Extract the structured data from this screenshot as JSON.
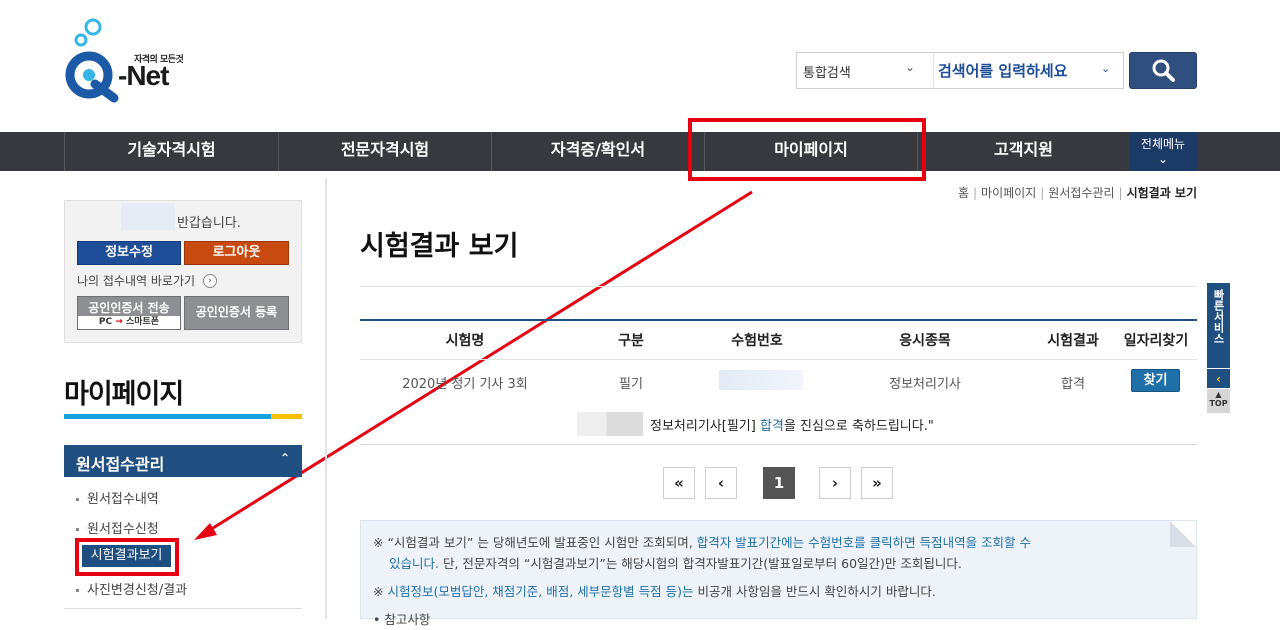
{
  "header": {
    "logo_tagline": "자격의 모든것",
    "logo_text": "-Net",
    "search_category": "통합검색",
    "search_placeholder": "검색어를 입력하세요"
  },
  "nav": {
    "items": [
      "기술자격시험",
      "전문자격시험",
      "자격증/확인서",
      "마이페이지",
      "고객지원"
    ],
    "all_menu": "전체메뉴"
  },
  "sidebar": {
    "greeting": "반갑습니다.",
    "edit_info": "정보수정",
    "logout": "로그아웃",
    "shortcut": "나의 접수내역 바로가기",
    "cert_send": "공인인증서 전송",
    "cert_send_sub_from": "PC",
    "cert_send_sub_to": "스마트폰",
    "cert_register": "공인인증서 등록",
    "section_title": "마이페이지",
    "menu_head": "원서접수관리",
    "items": [
      "원서접수내역",
      "원서접수신청",
      "시험결과보기",
      "사진변경신청/결과"
    ]
  },
  "main": {
    "breadcrumb": [
      "홈",
      "마이페이지",
      "원서접수관리",
      "시험결과 보기"
    ],
    "title": "시험결과 보기",
    "table": {
      "headers": [
        "시험명",
        "구분",
        "수험번호",
        "응시종목",
        "시험결과",
        "일자리찾기"
      ],
      "row": {
        "exam": "2020년 정기 기사 3회",
        "type": "필기",
        "subject": "정보처리기사",
        "result": "합격",
        "find_btn": "찾기"
      }
    },
    "congrats_pre": "정보처리기사[필기]",
    "congrats_hl": "합격",
    "congrats_post": "을 진심으로 축하드립니다.\"",
    "pagination": [
      "«",
      "‹",
      "1",
      "›",
      "»"
    ],
    "notice": {
      "line1_a": "※ “시험결과 보기” 는 당해년도에 발표중인 시험만 조회되며, ",
      "line1_b": "합격자 발표기간에는 수험번호를 클릭하면 득점내역을 조회할 수",
      "line2_a": "있습니다.",
      "line2_b": " 단, 전문자격의 “시험결과보기”는 해당시험의 합격자발표기간(발표일로부터 60일간)만 조회됩니다.",
      "line3_a": "※ ",
      "line3_b": "시험정보(모범답안, 채점기준, 배점, 세부문항별 득점 등)는",
      "line3_c": " 비공개 사항임을 반드시 확인하시기 바랍니다.",
      "line4": "• 참고사항"
    }
  },
  "quick": {
    "label": "빠른서비스",
    "top": "TOP"
  },
  "colors": {
    "nav_bg": "#38393e",
    "primary": "#1f4e80",
    "highlight_red": "#e60012",
    "link_blue": "#1f6fa8"
  }
}
